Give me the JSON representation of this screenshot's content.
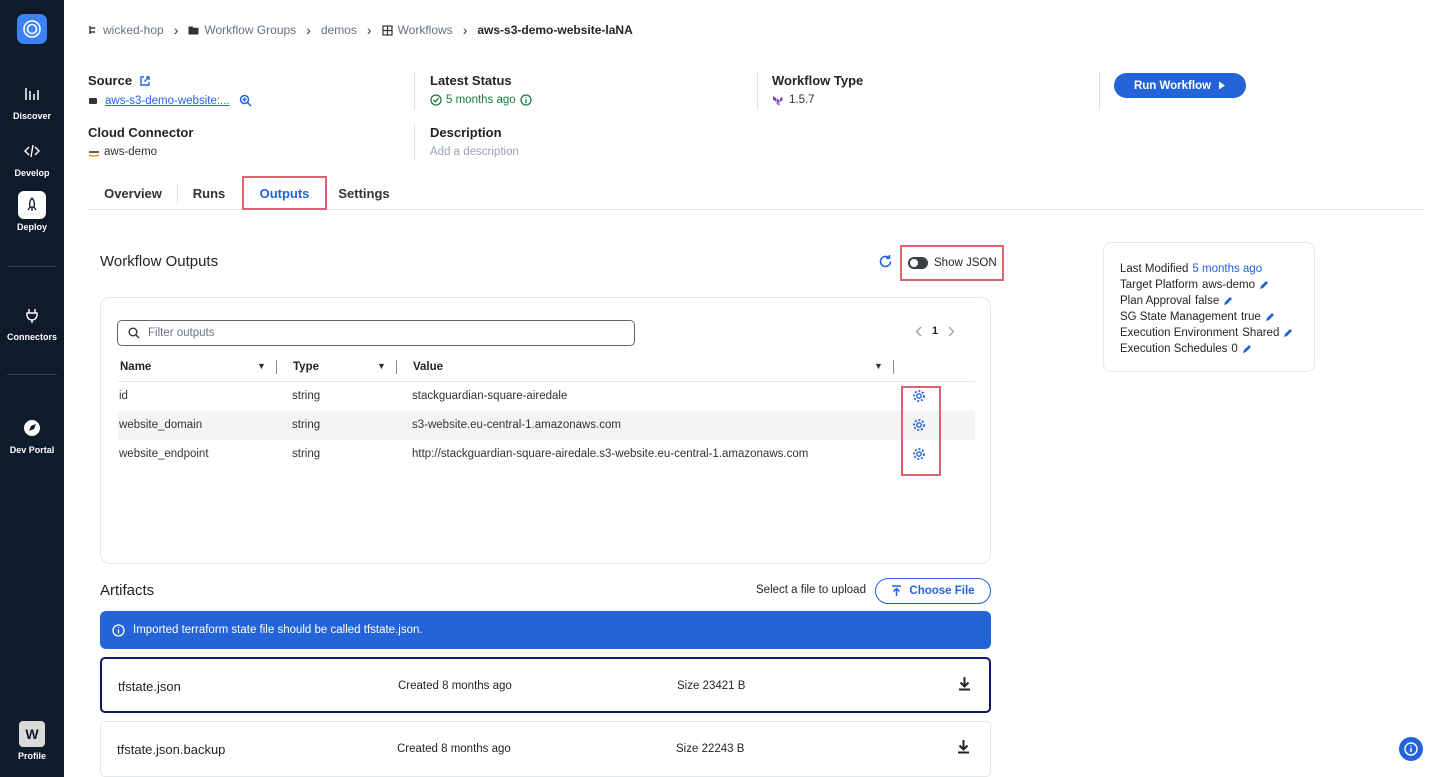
{
  "sidebar": {
    "items": [
      {
        "label": "Discover",
        "icon": "bar-chart-icon"
      },
      {
        "label": "Develop",
        "icon": "code-icon"
      },
      {
        "label": "Deploy",
        "icon": "rocket-icon"
      },
      {
        "label": "Connectors",
        "icon": "plug-icon"
      },
      {
        "label": "Dev Portal",
        "icon": "portal-icon"
      }
    ],
    "profile": {
      "initial": "W",
      "label": "Profile"
    }
  },
  "breadcrumb": {
    "org": "wicked-hop",
    "groups": "Workflow Groups",
    "group": "demos",
    "workflows": "Workflows",
    "current": "aws-s3-demo-website-laNA"
  },
  "header": {
    "source_label": "Source",
    "source_value": "aws-s3-demo-website:...",
    "status_label": "Latest Status",
    "status_value": "5 months ago",
    "type_label": "Workflow Type",
    "type_value": "1.5.7",
    "connector_label": "Cloud Connector",
    "connector_value": "aws-demo",
    "description_label": "Description",
    "description_placeholder": "Add a description",
    "run_label": "Run Workflow"
  },
  "tabs": [
    {
      "label": "Overview"
    },
    {
      "label": "Runs"
    },
    {
      "label": "Outputs"
    },
    {
      "label": "Settings"
    }
  ],
  "outputs": {
    "title": "Workflow Outputs",
    "toggle_label": "Show JSON",
    "filter_placeholder": "Filter outputs",
    "page": "1",
    "columns": [
      "Name",
      "Type",
      "Value"
    ],
    "rows": [
      {
        "name": "id",
        "type": "string",
        "value": "stackguardian-square-airedale"
      },
      {
        "name": "website_domain",
        "type": "string",
        "value": "s3-website.eu-central-1.amazonaws.com"
      },
      {
        "name": "website_endpoint",
        "type": "string",
        "value": "http://stackguardian-square-airedale.s3-website.eu-central-1.amazonaws.com"
      }
    ]
  },
  "artifacts": {
    "title": "Artifacts",
    "upload_label": "Select a file to upload",
    "choose_label": "Choose File",
    "alert": "Imported terraform state file should be called tfstate.json.",
    "files": [
      {
        "name": "tfstate.json",
        "created": "Created 8 months ago",
        "size": "Size 23421 B"
      },
      {
        "name": "tfstate.json.backup",
        "created": "Created 8 months ago",
        "size": "Size 22243 B"
      }
    ]
  },
  "meta": {
    "last_modified_label": "Last Modified",
    "last_modified_value": "5 months ago",
    "target_label": "Target Platform",
    "target_value": "aws-demo",
    "plan_label": "Plan Approval",
    "plan_value": "false",
    "sg_label": "SG State Management",
    "sg_value": "true",
    "env_label": "Execution Environment",
    "env_value": "Shared",
    "sched_label": "Execution Schedules",
    "sched_value": "0"
  },
  "colors": {
    "accent": "#2563d8",
    "sidebar": "#0f1a2b",
    "highlight": "#d9666f",
    "success": "#16803c"
  }
}
